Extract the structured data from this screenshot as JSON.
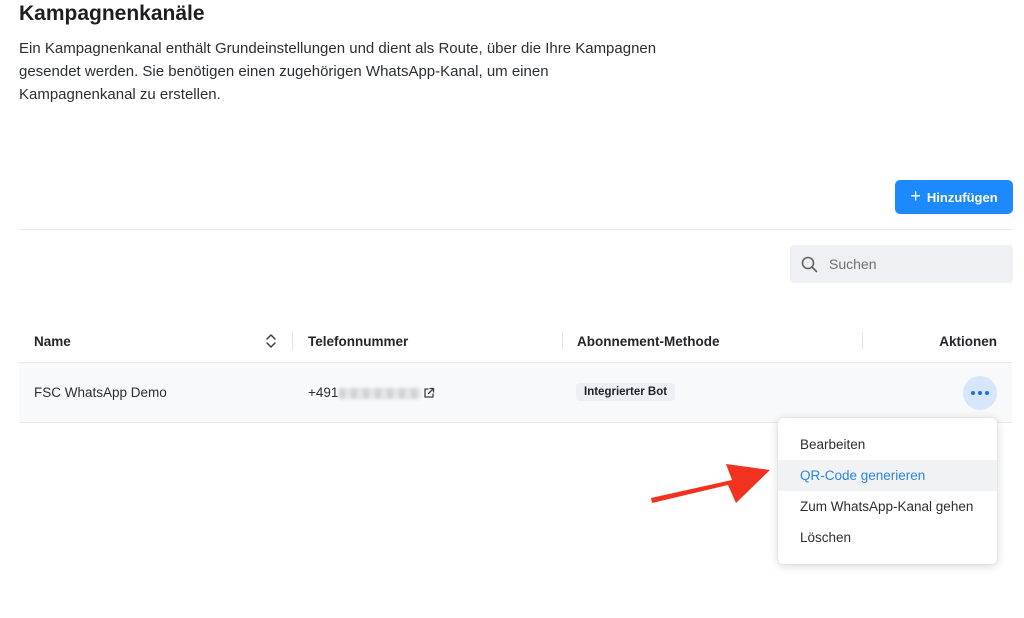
{
  "header": {
    "title": "Kampagnenkanäle",
    "description": "Ein Kampagnenkanal enthält Grundeinstellungen und dient als Route, über die Ihre Kampagnen gesendet werden. Sie benötigen einen zugehörigen WhatsApp-Kanal, um einen Kampagnenkanal zu erstellen."
  },
  "toolbar": {
    "add_label": "Hinzufügen"
  },
  "search": {
    "placeholder": "Suchen"
  },
  "table": {
    "columns": {
      "name": "Name",
      "phone": "Telefonnummer",
      "subscription": "Abonnement-Methode",
      "actions": "Aktionen"
    },
    "rows": [
      {
        "name": "FSC WhatsApp Demo",
        "phone_prefix": "+491",
        "subscription": "Integrierter Bot"
      }
    ]
  },
  "menu": {
    "items": [
      "Bearbeiten",
      "QR-Code generieren",
      "Zum WhatsApp-Kanal gehen",
      "Löschen"
    ],
    "highlighted": "QR-Code generieren"
  },
  "colors": {
    "primary": "#1c89ff",
    "link": "#2c86e0",
    "arrow": "#f0321f"
  },
  "icons": {
    "add": "plus-icon",
    "search": "search-icon",
    "sort": "sort-icon",
    "external_link": "external-link-icon",
    "actions": "more-horizontal-icon",
    "annotation": "arrow-annotation"
  }
}
